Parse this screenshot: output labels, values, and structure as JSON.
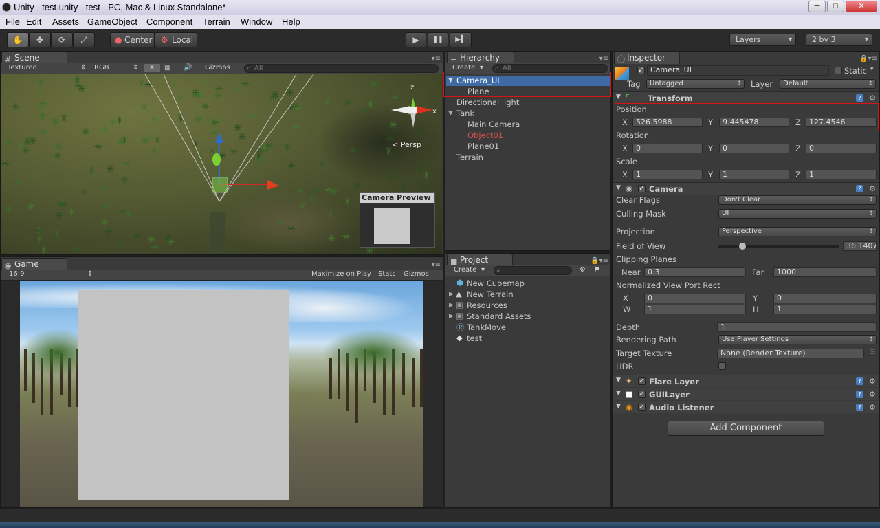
{
  "window": {
    "title": "Unity - test.unity - test - PC, Mac & Linux Standalone*",
    "min": "─",
    "max": "□",
    "close": "✕"
  },
  "menu": [
    "File",
    "Edit",
    "Assets",
    "GameObject",
    "Component",
    "Terrain",
    "Window",
    "Help"
  ],
  "toolbar": {
    "tools": [
      "hand-icon",
      "move-icon",
      "rotate-icon",
      "scale-icon"
    ],
    "pivot": "Center",
    "space": "Local",
    "play": "▶",
    "pause": "❚❚",
    "step": "▶▌",
    "layers": "Layers",
    "layout": "2 by 3"
  },
  "scene": {
    "tab": "Scene",
    "shading": "Textured",
    "render": "RGB",
    "gizmos": "Gizmos",
    "search": "All",
    "persp": "< Persp",
    "preview_title": "Camera Preview",
    "axis_x": "x",
    "axis_z": "z"
  },
  "game": {
    "tab": "Game",
    "aspect": "16:9",
    "maximize": "Maximize on Play",
    "stats": "Stats",
    "gizmos": "Gizmos"
  },
  "hierarchy": {
    "tab": "Hierarchy",
    "create": "Create",
    "search": "All",
    "items": [
      "Camera_UI",
      "Plane",
      "Directional light",
      "Tank",
      "Main Camera",
      "Object01",
      "Plane01",
      "Terrain"
    ]
  },
  "project": {
    "tab": "Project",
    "create": "Create",
    "items": [
      "New Cubemap",
      "New Terrain",
      "Resources",
      "Standard Assets",
      "TankMove",
      "test"
    ]
  },
  "inspector": {
    "tab": "Inspector",
    "name": "Camera_UI",
    "static": "Static",
    "tag_label": "Tag",
    "tag": "Untagged",
    "layer_label": "Layer",
    "layer": "Default",
    "transform": {
      "title": "Transform",
      "position_label": "Position",
      "rotation_label": "Rotation",
      "scale_label": "Scale",
      "x": "X",
      "y": "Y",
      "z": "Z",
      "position": [
        "526.5988",
        "9.445478",
        "127.4546"
      ],
      "rotation": [
        "0",
        "0",
        "0"
      ],
      "scale": [
        "1",
        "1",
        "1"
      ]
    },
    "camera": {
      "title": "Camera",
      "clear_flags_label": "Clear Flags",
      "clear_flags": "Don't Clear",
      "culling_label": "Culling Mask",
      "culling": "UI",
      "projection_label": "Projection",
      "projection": "Perspective",
      "fov_label": "Field of View",
      "fov": "36.1407",
      "fov_fraction": 0.2,
      "clipping_label": "Clipping Planes",
      "near_label": "Near",
      "near": "0.3",
      "far_label": "Far",
      "far": "1000",
      "viewport_label": "Normalized View Port Rect",
      "vp_x_label": "X",
      "vp_x": "0",
      "vp_y_label": "Y",
      "vp_y": "0",
      "vp_w_label": "W",
      "vp_w": "1",
      "vp_h_label": "H",
      "vp_h": "1",
      "depth_label": "Depth",
      "depth": "1",
      "rendering_label": "Rendering Path",
      "rendering": "Use Player Settings",
      "target_label": "Target Texture",
      "target": "None (Render Texture)",
      "hdr_label": "HDR"
    },
    "flare": "Flare Layer",
    "gui": "GUILayer",
    "audio": "Audio Listener",
    "add_component": "Add Component"
  },
  "colors": {
    "highlight": "#d11111",
    "selection": "#3e6aa5",
    "missing": "#d05050"
  }
}
